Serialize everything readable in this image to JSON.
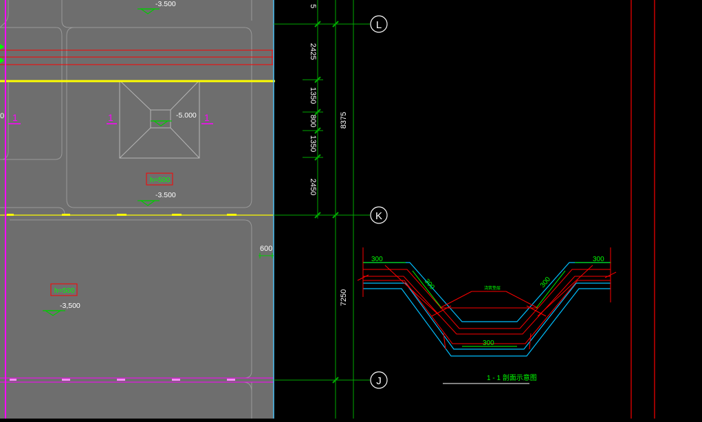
{
  "drawing": {
    "elevation_labels": {
      "top": "-3.500",
      "pit_center": "-5.000",
      "mid": "-3.500",
      "lower": "-3,500"
    },
    "section_marks": {
      "left_partial": "1",
      "left": "1",
      "right": "1"
    },
    "thickness_tags": {
      "upper": "h=500",
      "lower": "h=500"
    },
    "offset_600": "600",
    "axes": {
      "L": "L",
      "K": "K",
      "J": "J"
    },
    "dims_vertical": {
      "top_partial": "5",
      "d2425": "2425",
      "d1350a": "1350",
      "d800": "800",
      "d1350b": "1350",
      "d2450": "2450",
      "total_8375": "8375",
      "total_7250": "7250"
    },
    "section_detail": {
      "dim_300_left": "300",
      "dim_300_right": "300",
      "dim_300_slope_left": "300",
      "dim_300_slope_right": "300",
      "dim_300_bottom": "300",
      "note": "浇筑垫层",
      "title": "1 - 1 剖面示意图"
    },
    "colors": {
      "background": "#000000",
      "slab_fill": "#6e6e6e",
      "magenta": "#ff00ff",
      "yellow": "#ffff00",
      "red": "#ff0000",
      "cyan": "#00bfff",
      "green": "#00ff00",
      "white": "#ffffff"
    }
  }
}
